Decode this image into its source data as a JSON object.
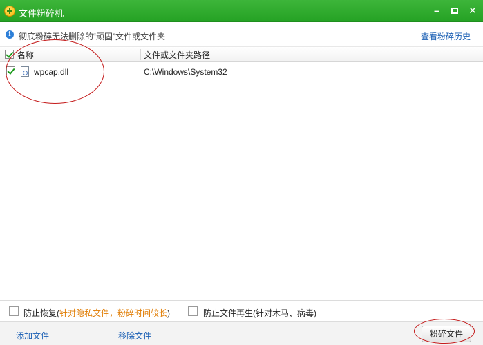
{
  "window": {
    "title": "文件粉碎机",
    "minimize_glyph": "–",
    "close_glyph": "✕"
  },
  "info": {
    "icon_glyph": "i",
    "text": "彻底粉碎无法删除的“顽固”文件或文件夹",
    "history_link": "查看粉碎历史"
  },
  "list": {
    "columns": [
      "名称",
      "文件或文件夹路径"
    ],
    "rows": [
      {
        "checked": true,
        "name": "wpcap.dll",
        "path": "C:\\Windows\\System32"
      }
    ]
  },
  "options": {
    "prevent_recovery": {
      "label": "防止恢复",
      "note_open": "(",
      "note": "针对隐私文件，粉碎时间较长",
      "note_close": ")",
      "checked": false
    },
    "prevent_regen": {
      "label": "防止文件再生",
      "note": "(针对木马、病毒)",
      "checked": false
    }
  },
  "footer": {
    "add_file": "添加文件",
    "remove_file": "移除文件",
    "shred_button": "粉碎文件"
  },
  "colors": {
    "titlebar": "#2fae2c",
    "link": "#1a5fb4",
    "note": "#e07b00",
    "annotation": "#c41a1a"
  }
}
